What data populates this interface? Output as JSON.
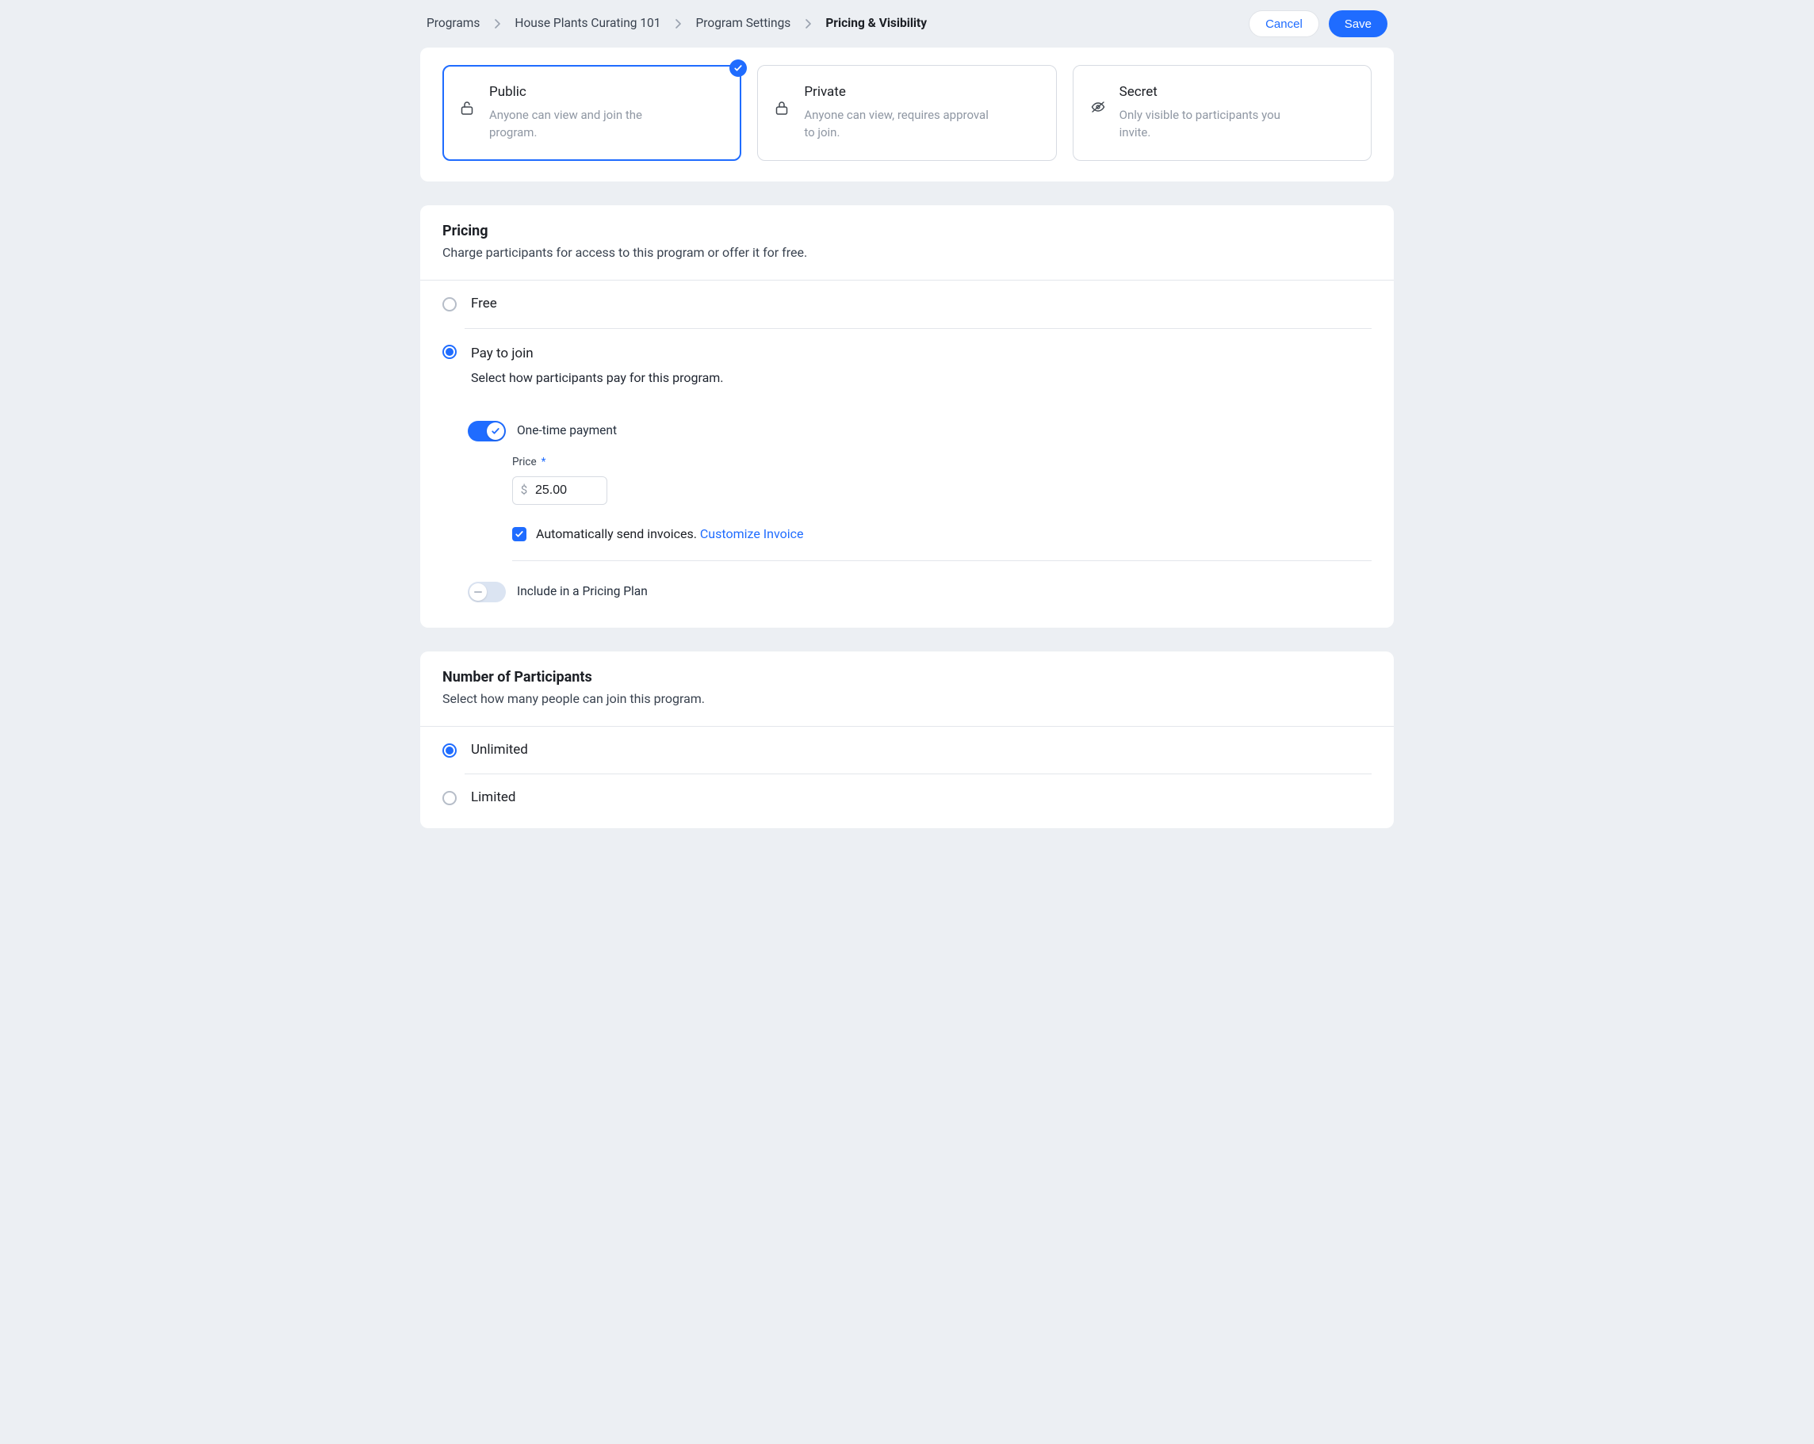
{
  "breadcrumb": {
    "items": [
      "Programs",
      "House Plants Curating 101",
      "Program Settings",
      "Pricing & Visibility"
    ],
    "current_index": 3
  },
  "header": {
    "cancel": "Cancel",
    "save": "Save"
  },
  "visibility": {
    "selected": 0,
    "options": [
      {
        "title": "Public",
        "desc": "Anyone can view and join the program.",
        "icon": "lock-open-icon"
      },
      {
        "title": "Private",
        "desc": "Anyone can view, requires approval to join.",
        "icon": "lock-icon"
      },
      {
        "title": "Secret",
        "desc": "Only visible to participants you invite.",
        "icon": "eye-off-icon"
      }
    ]
  },
  "pricing": {
    "title": "Pricing",
    "subtitle": "Charge participants for access to this program or offer it for free.",
    "free_label": "Free",
    "pay_label": "Pay to join",
    "pay_subtitle": "Select how participants pay for this program.",
    "selected": "pay",
    "one_time": {
      "enabled": true,
      "label": "One-time payment",
      "price_label": "Price",
      "currency": "$",
      "price_value": "25.00",
      "auto_invoice_checked": true,
      "auto_invoice_label": "Automatically send invoices.",
      "customize_link": "Customize Invoice"
    },
    "plan": {
      "enabled": false,
      "label": "Include in a Pricing Plan"
    }
  },
  "participants": {
    "title": "Number of Participants",
    "subtitle": "Select how many people can join this program.",
    "selected": "unlimited",
    "unlimited_label": "Unlimited",
    "limited_label": "Limited"
  }
}
